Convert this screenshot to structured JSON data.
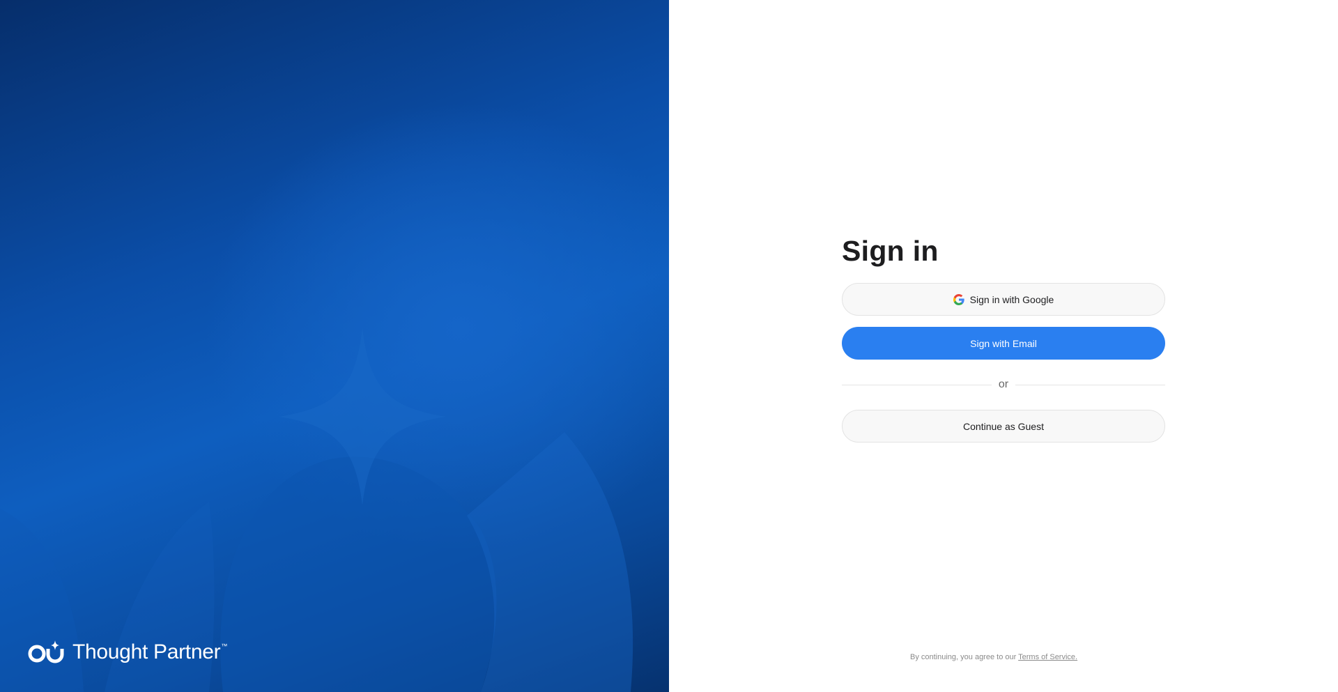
{
  "brand": {
    "name": "Thought Partner",
    "trademark": "™",
    "logo_icon": "thought-partner-logo-icon",
    "colors": {
      "panel_dark": "#062e6b",
      "panel_mid": "#0e5ebf"
    }
  },
  "signin": {
    "title": "Sign in",
    "google_button_label": "Sign in with Google",
    "google_icon": "google-g-icon",
    "email_button_label": "Sign with Email",
    "divider_text": "or",
    "guest_button_label": "Continue as Guest"
  },
  "legal": {
    "prefix": "By continuing, you agree to our ",
    "terms_link": "Terms of Service."
  },
  "colors": {
    "accent": "#2a7ff0",
    "title_text": "#1d1d1f",
    "muted_text": "#8a8a8a"
  }
}
